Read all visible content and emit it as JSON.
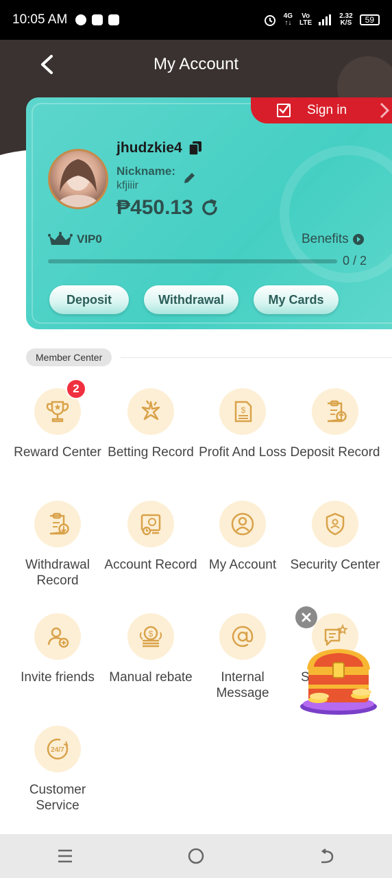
{
  "status_bar": {
    "time": "10:05 AM",
    "net_top": "4G",
    "net_mid": "Vo",
    "net_bot": "LTE",
    "speed": "2.32",
    "speed_unit": "K/S",
    "battery": "59"
  },
  "header": {
    "title": "My Account"
  },
  "account_card": {
    "sign_in_label": "Sign in",
    "username": "jhudzkie4",
    "nickname_label": "Nickname:",
    "nickname": "kfjiiir",
    "balance": "₱450.13",
    "vip_label": "VIP0",
    "benefits_label": "Benefits",
    "progress_text": "0 / 2",
    "progress_fraction": 0,
    "buttons": {
      "deposit": "Deposit",
      "withdrawal": "Withdrawal",
      "my_cards": "My Cards"
    },
    "accent_color": "#4fd2c7"
  },
  "member_center": {
    "title": "Member Center",
    "items": [
      {
        "label": "Reward Center",
        "icon": "trophy-icon",
        "badge": "2"
      },
      {
        "label": "Betting Record",
        "icon": "betting-icon"
      },
      {
        "label": "Profit And Loss",
        "icon": "receipt-icon"
      },
      {
        "label": "Deposit Record",
        "icon": "deposit-clipboard-icon"
      },
      {
        "label": "Withdrawal Record",
        "icon": "withdraw-clipboard-icon"
      },
      {
        "label": "Account Record",
        "icon": "account-record-icon"
      },
      {
        "label": "My Account",
        "icon": "user-circle-icon"
      },
      {
        "label": "Security Center",
        "icon": "shield-icon"
      },
      {
        "label": "Invite friends",
        "icon": "invite-user-icon"
      },
      {
        "label": "Manual rebate",
        "icon": "coins-icon"
      },
      {
        "label": "Internal Message",
        "icon": "at-sign-icon"
      },
      {
        "label": "S",
        "icon": "chat-star-icon"
      },
      {
        "label": "Customer Service",
        "icon": "service-24-7-icon"
      }
    ],
    "icon_bg_color": "#fdefd5",
    "icon_color": "#d9a24a"
  }
}
